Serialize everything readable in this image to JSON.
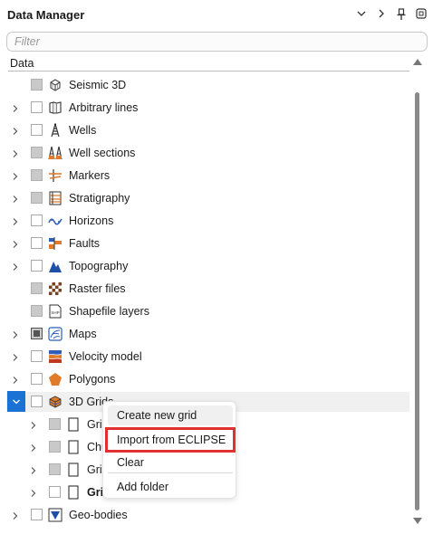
{
  "panel": {
    "title": "Data Manager",
    "buttons": [
      "∨",
      "›",
      "pin",
      "restore"
    ],
    "filter_placeholder": "Filter",
    "column_header": "Data"
  },
  "tree": [
    {
      "label": "Seismic 3D",
      "icon": "seismic-cube-icon",
      "expandable": false,
      "check": "filled"
    },
    {
      "label": "Arbitrary lines",
      "icon": "arbitrary-lines-icon",
      "expandable": true,
      "check": "empty"
    },
    {
      "label": "Wells",
      "icon": "well-derrick-icon",
      "expandable": true,
      "check": "empty"
    },
    {
      "label": "Well sections",
      "icon": "well-sections-icon",
      "expandable": true,
      "check": "filled"
    },
    {
      "label": "Markers",
      "icon": "markers-icon",
      "expandable": true,
      "check": "filled"
    },
    {
      "label": "Stratigraphy",
      "icon": "stratigraphy-icon",
      "expandable": true,
      "check": "filled"
    },
    {
      "label": "Horizons",
      "icon": "horizons-icon",
      "expandable": true,
      "check": "empty"
    },
    {
      "label": "Faults",
      "icon": "faults-icon",
      "expandable": true,
      "check": "empty"
    },
    {
      "label": "Topography",
      "icon": "topography-icon",
      "expandable": true,
      "check": "empty"
    },
    {
      "label": "Raster files",
      "icon": "raster-icon",
      "expandable": false,
      "check": "filled"
    },
    {
      "label": "Shapefile layers",
      "icon": "shapefile-icon",
      "expandable": false,
      "check": "filled"
    },
    {
      "label": "Maps",
      "icon": "maps-icon",
      "expandable": true,
      "check": "filled-dark"
    },
    {
      "label": "Velocity model",
      "icon": "velocity-model-icon",
      "expandable": true,
      "check": "empty"
    },
    {
      "label": "Polygons",
      "icon": "polygons-icon",
      "expandable": true,
      "check": "empty"
    },
    {
      "label": "3D Grids",
      "icon": "grid-3d-icon",
      "expandable": true,
      "expanded": true,
      "check": "empty"
    },
    {
      "label": "Gri",
      "icon": "document-icon",
      "expandable": true,
      "check": "filled",
      "child": true
    },
    {
      "label": "Chu",
      "icon": "document-icon",
      "expandable": true,
      "check": "filled",
      "child": true
    },
    {
      "label": "Gri",
      "icon": "document-icon",
      "expandable": true,
      "check": "filled",
      "child": true
    },
    {
      "label": "Gri",
      "icon": "document-icon",
      "expandable": true,
      "check": "empty",
      "child": true,
      "bold": true
    },
    {
      "label": "Geo-bodies",
      "icon": "geo-bodies-icon",
      "expandable": true,
      "check": "empty"
    }
  ],
  "context_menu": {
    "items": [
      {
        "label": "Create new grid"
      },
      {
        "label": "Import from ECLIPSE"
      },
      {
        "label": "Clear"
      },
      {
        "label": "Add folder"
      }
    ]
  },
  "colors": {
    "selection_blue": "#1a73d4",
    "highlight_red": "#e03030"
  }
}
